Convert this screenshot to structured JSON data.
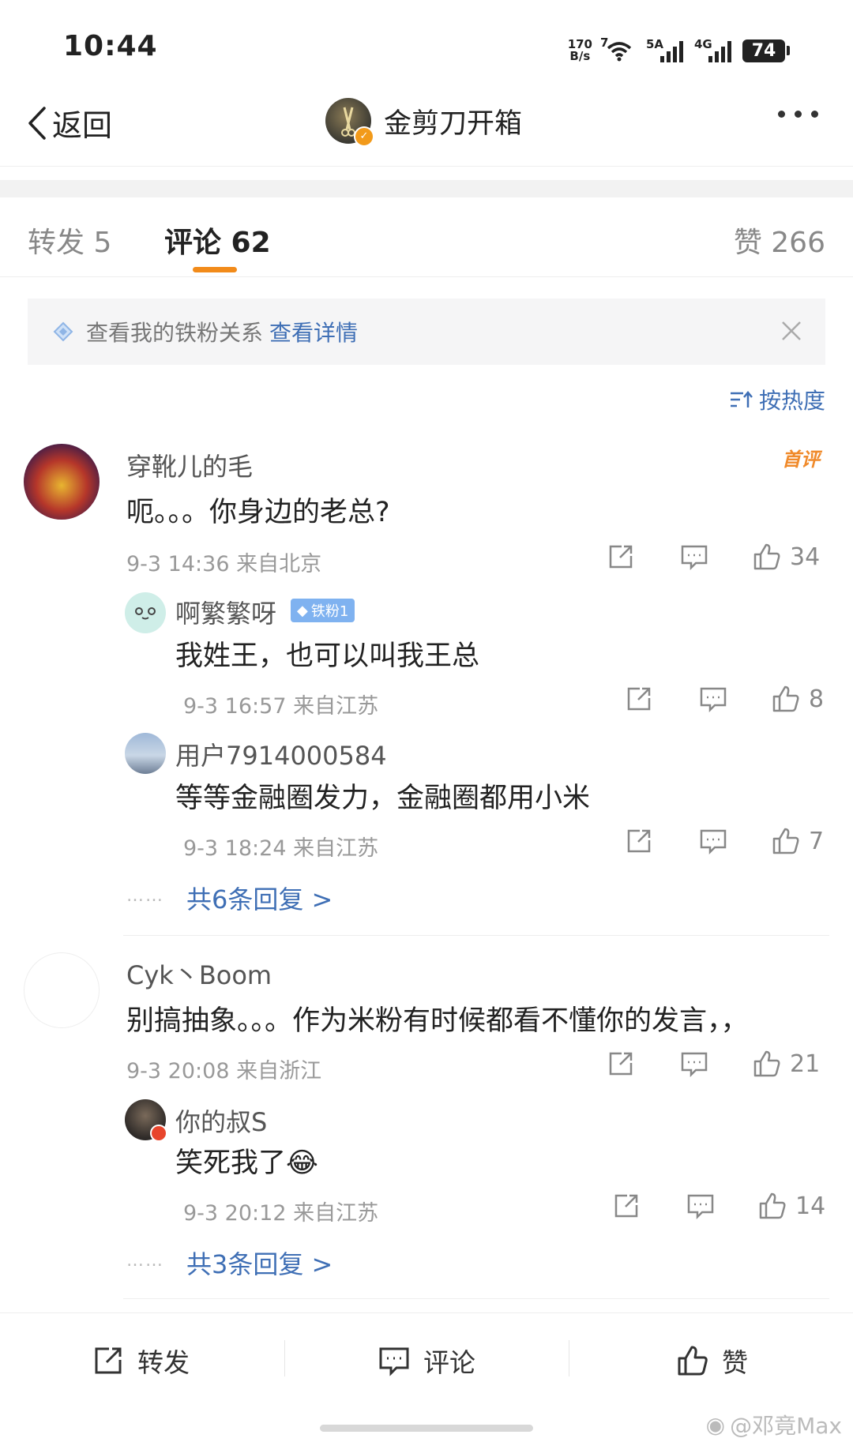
{
  "status_bar": {
    "time": "10:44",
    "net_speed_value": "170",
    "net_speed_unit": "B/s",
    "wifi_label": "7",
    "sig1_label": "5A",
    "sig2_label": "4G",
    "battery": "74"
  },
  "nav": {
    "back_label": "返回",
    "title": "金剪刀开箱"
  },
  "tabs": {
    "repost": "转发 5",
    "comments": "评论 62",
    "likes": "赞 266"
  },
  "fan_banner": {
    "text": "查看我的铁粉关系",
    "link": "查看详情"
  },
  "sort": {
    "label": "按热度"
  },
  "comments": [
    {
      "user": "穿靴儿的毛",
      "badge": "首评",
      "text": "呃。。。你身边的老总?",
      "meta": "9-3 14:36 来自北京",
      "likes": "34",
      "replies": [
        {
          "user": "啊繁繁呀",
          "iron_badge": "铁粉1",
          "text": "我姓王，也可以叫我王总",
          "meta": "9-3 16:57 来自江苏",
          "likes": "8"
        },
        {
          "user": "用户7914000584",
          "text": "等等金融圈发力，金融圈都用小米",
          "meta": "9-3 18:24 来自江苏",
          "likes": "7"
        }
      ],
      "more_replies": "共6条回复 >"
    },
    {
      "user": "Cyk丶Boom",
      "text": "别搞抽象。。。作为米粉有时候都看不懂你的发言，，",
      "meta": "9-3 20:08 来自浙江",
      "likes": "21",
      "replies": [
        {
          "user": "你的叔S",
          "text": "笑死我了😂",
          "meta": "9-3 20:12 来自江苏",
          "likes": "14"
        }
      ],
      "more_replies": "共3条回复 >"
    }
  ],
  "more_dots": "……",
  "bottom_bar": {
    "repost": "转发",
    "comment": "评论",
    "like": "赞"
  },
  "watermark": "@邓竟Max",
  "colors": {
    "accent": "#f28b1a",
    "link": "#3f6fb5"
  }
}
